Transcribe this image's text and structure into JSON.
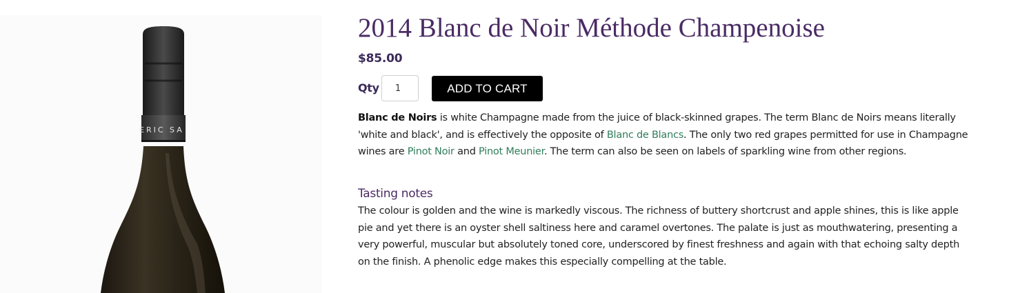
{
  "product": {
    "title": "2014 Blanc de Noir Méthode Champenoise",
    "price": "$85.00",
    "image_label": "ERIC SA"
  },
  "cart": {
    "qty_label": "Qty",
    "qty_value": "1",
    "add_label": "ADD TO CART"
  },
  "description": {
    "bold_term": "Blanc de Noirs",
    "text_1": " is white Champagne made from the juice of black-skinned grapes. The term Blanc de Noirs means literally 'white and black', and is effectively the opposite of ",
    "link_1": "Blanc de Blancs",
    "text_2": ". The only two red grapes permitted for use in Champagne wines are ",
    "link_2": "Pinot Noir",
    "text_3": " and ",
    "link_3": "Pinot Meunier",
    "text_4": ". The term can also be seen on labels of sparkling wine from other regions."
  },
  "tasting_notes": {
    "heading": "Tasting notes",
    "text": "The colour is golden and the wine is markedly viscous. The richness of buttery shortcrust and apple shines, this is like apple pie and yet there is an oyster shell saltiness here and caramel overtones. The palate is just as mouthwatering, presenting a very powerful, muscular but absolutely toned core, underscored by finest freshness and again with that echoing salty depth on the finish. A phenolic edge makes this especially compelling at the table."
  },
  "colors": {
    "title": "#4a2b64",
    "price": "#3b2a5a",
    "link": "#2f7d5b",
    "button_bg": "#000000",
    "button_text": "#ffffff"
  }
}
